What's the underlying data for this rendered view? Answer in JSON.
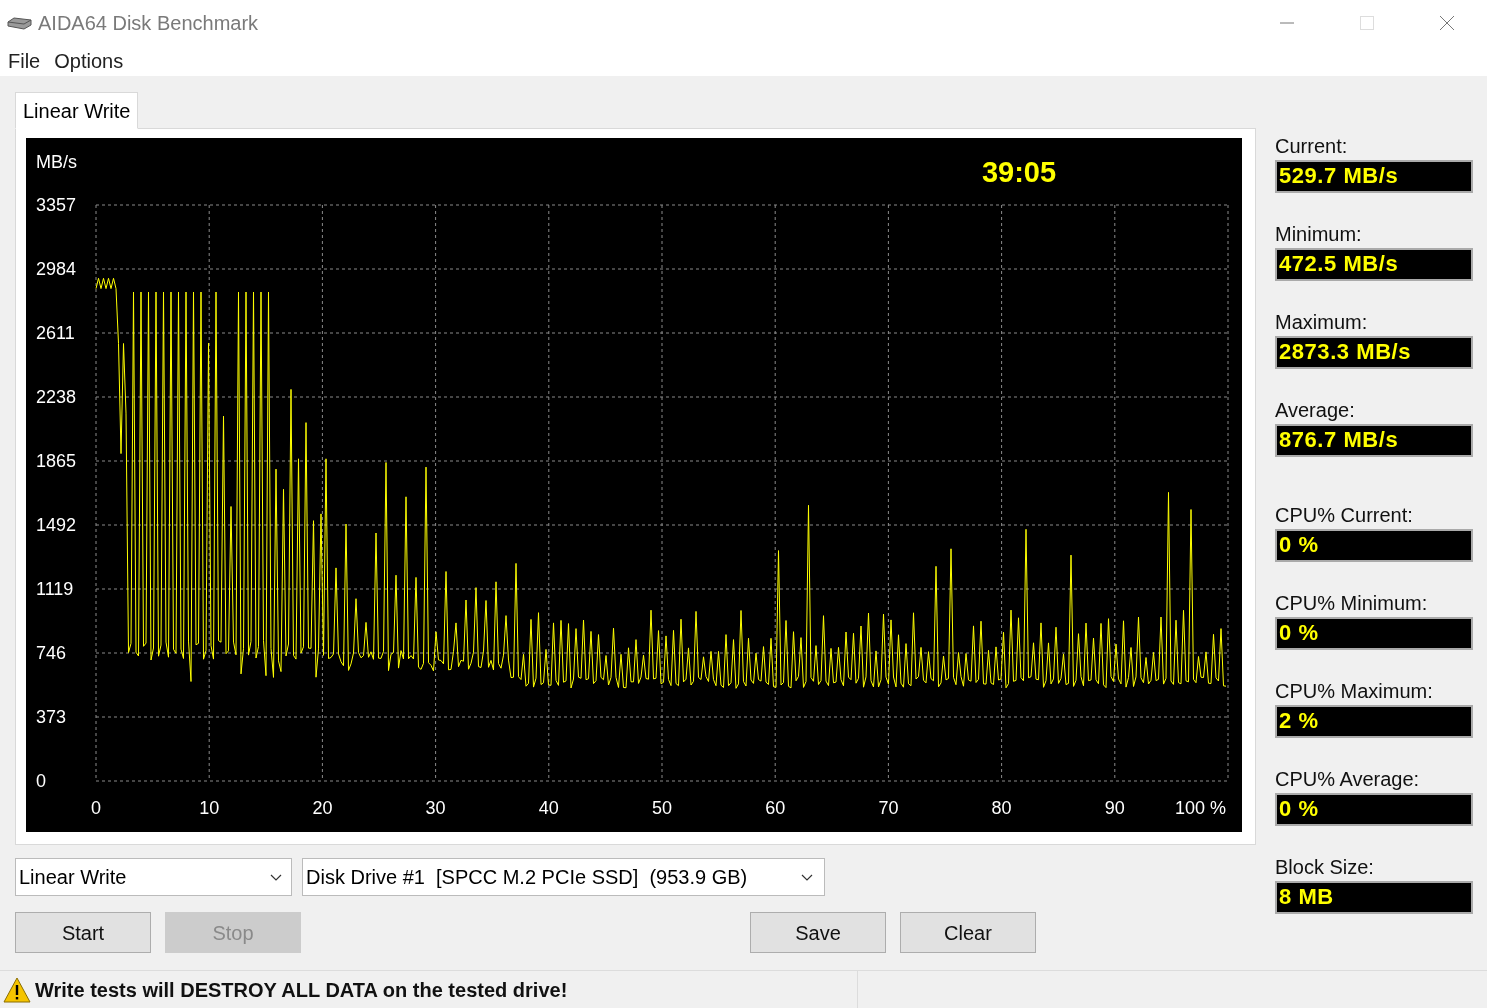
{
  "window": {
    "title": "AIDA64 Disk Benchmark"
  },
  "menu": [
    "File",
    "Options"
  ],
  "tabs": [
    {
      "label": "Linear Write",
      "selected": true
    }
  ],
  "chart": {
    "unit": "MB/s",
    "timer": "39:05",
    "yticks": [
      "3357",
      "2984",
      "2611",
      "2238",
      "1865",
      "1492",
      "1119",
      "746",
      "373",
      "0"
    ],
    "xticks": [
      "0",
      "10",
      "20",
      "30",
      "40",
      "50",
      "60",
      "70",
      "80",
      "90",
      "100 %"
    ]
  },
  "stats": [
    {
      "label": "Current:",
      "value": "529.7 MB/s"
    },
    {
      "label": "Minimum:",
      "value": "472.5 MB/s"
    },
    {
      "label": "Maximum:",
      "value": "2873.3 MB/s"
    },
    {
      "label": "Average:",
      "value": "876.7 MB/s"
    },
    {
      "label": "CPU% Current:",
      "value": "0 %"
    },
    {
      "label": "CPU% Minimum:",
      "value": "0 %"
    },
    {
      "label": "CPU% Maximum:",
      "value": "2 %"
    },
    {
      "label": "CPU% Average:",
      "value": "0 %"
    },
    {
      "label": "Block Size:",
      "value": "8 MB"
    }
  ],
  "test_select": {
    "value": "Linear Write"
  },
  "drive_select": {
    "value": "Disk Drive #1  [SPCC M.2 PCIe SSD]  (953.9 GB)"
  },
  "buttons": [
    {
      "label": "Start",
      "disabled": false
    },
    {
      "label": "Stop",
      "disabled": true
    },
    {
      "label": "Save",
      "disabled": false
    },
    {
      "label": "Clear",
      "disabled": false
    }
  ],
  "status": {
    "warning": "Write tests will DESTROY ALL DATA on the tested drive!"
  }
}
